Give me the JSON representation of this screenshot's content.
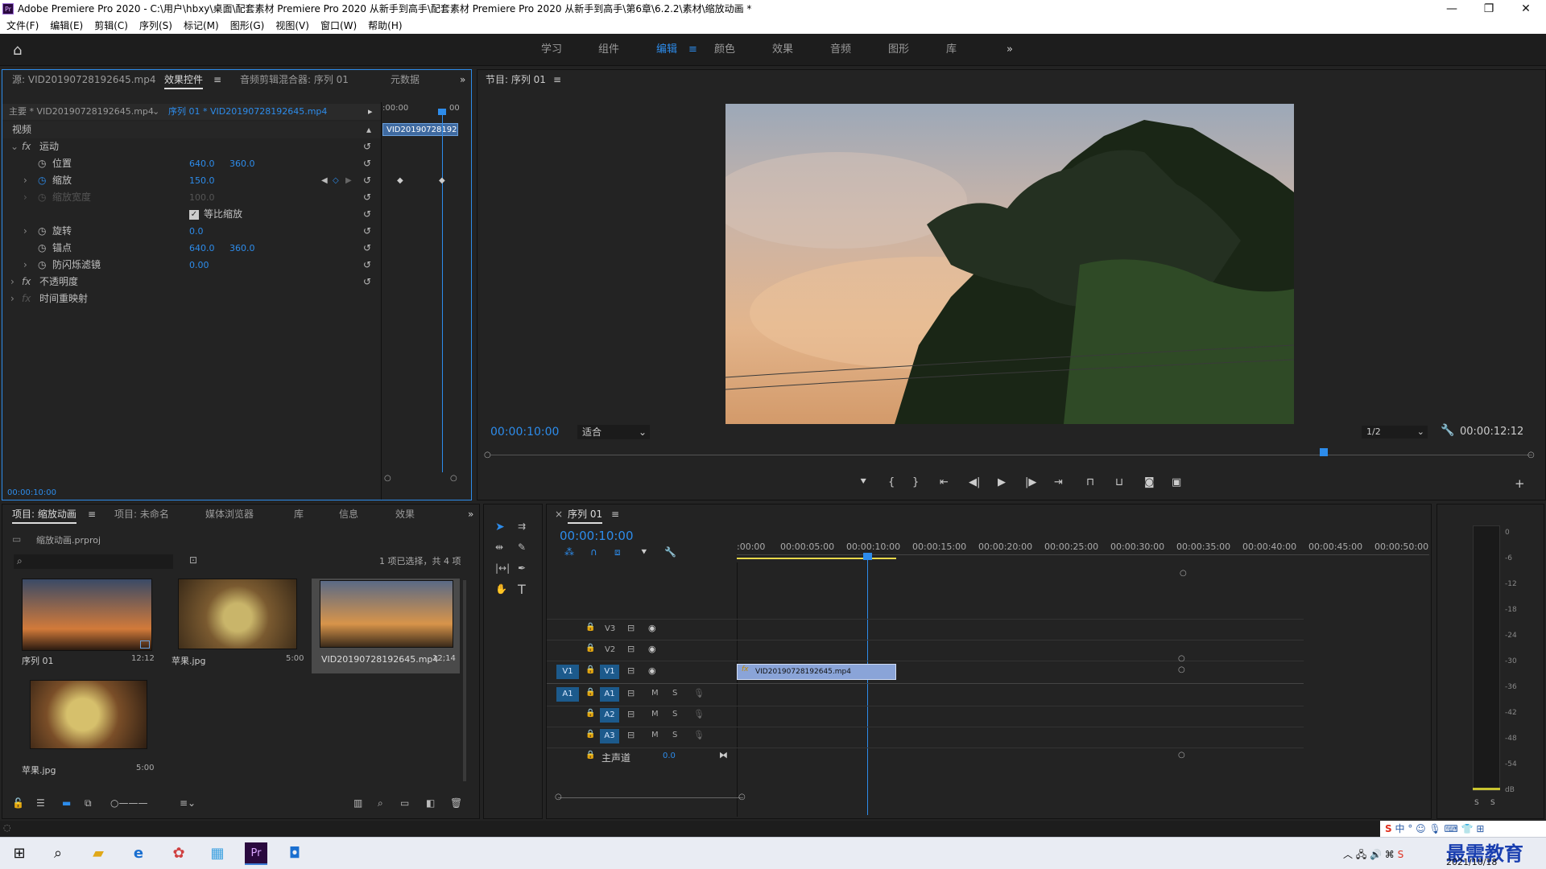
{
  "titlebar": {
    "title": "Adobe Premiere Pro 2020 - C:\\用户\\hbxy\\桌面\\配套素材 Premiere Pro 2020 从新手到高手\\配套素材 Premiere Pro 2020 从新手到高手\\第6章\\6.2.2\\素材\\缩放动画 *",
    "minimize": "—",
    "maximize": "❐",
    "close": "✕"
  },
  "menu": [
    "文件(F)",
    "编辑(E)",
    "剪辑(C)",
    "序列(S)",
    "标记(M)",
    "图形(G)",
    "视图(V)",
    "窗口(W)",
    "帮助(H)"
  ],
  "workspaces": [
    "学习",
    "组件",
    "编辑",
    "颜色",
    "效果",
    "音频",
    "图形",
    "库"
  ],
  "workspace_active": "编辑",
  "effect_panel": {
    "tabs": [
      "源: VID20190728192645.mp4",
      "效果控件",
      "音频剪辑混合器: 序列 01",
      "元数据"
    ],
    "master": "主要 * VID20190728192645.mp4",
    "seq": "序列 01 * VID20190728192645.mp4",
    "time_start": ":00:00",
    "time_end": "00",
    "clip_name": "VID20190728192645.mp4",
    "section_video": "视频",
    "motion": "运动",
    "props": [
      {
        "name": "位置",
        "v1": "640.0",
        "v2": "360.0"
      },
      {
        "name": "缩放",
        "v1": "150.0",
        "v2": ""
      },
      {
        "name": "缩放宽度",
        "v1": "100.0",
        "v2": ""
      },
      {
        "name": "等比缩放",
        "v1": "",
        "v2": ""
      },
      {
        "name": "旋转",
        "v1": "0.0",
        "v2": ""
      },
      {
        "name": "锚点",
        "v1": "640.0",
        "v2": "360.0"
      },
      {
        "name": "防闪烁滤镜",
        "v1": "0.00",
        "v2": ""
      }
    ],
    "opacity": "不透明度",
    "time_remap": "时间重映射",
    "timecode": "00:00:10:00"
  },
  "program_monitor": {
    "title": "节目: 序列 01",
    "timecode": "00:00:10:00",
    "fit": "适合",
    "quality": "1/2",
    "duration": "00:00:12:12"
  },
  "project_panel": {
    "tabs": [
      "项目: 缩放动画",
      "项目: 未命名",
      "媒体浏览器",
      "库",
      "信息",
      "效果"
    ],
    "project_file": "缩放动画.prproj",
    "selection": "1 项已选择，共 4 项",
    "items": [
      {
        "name": "序列 01",
        "duration": "12:12"
      },
      {
        "name": "苹果.jpg",
        "duration": "5:00"
      },
      {
        "name": "VID20190728192645.mp4",
        "duration": "12;14"
      },
      {
        "name": "苹果.jpg",
        "duration": "5:00"
      }
    ]
  },
  "timeline": {
    "title": "序列 01",
    "timecode": "00:00:10:00",
    "ruler": [
      ":00:00",
      "00:00:05:00",
      "00:00:10:00",
      "00:00:15:00",
      "00:00:20:00",
      "00:00:25:00",
      "00:00:30:00",
      "00:00:35:00",
      "00:00:40:00",
      "00:00:45:00",
      "00:00:50:00"
    ],
    "video_tracks": [
      "V3",
      "V2",
      "V1"
    ],
    "audio_tracks": [
      "A1",
      "A2",
      "A3"
    ],
    "master": "主声道",
    "master_val": "0.0",
    "clip": "VID20190728192645.mp4",
    "m": "M",
    "s": "S"
  },
  "meter": [
    "0",
    "-6",
    "-12",
    "-18",
    "-24",
    "-30",
    "-36",
    "-42",
    "-48",
    "-54",
    "dB"
  ],
  "meter_solo": [
    "S",
    "S"
  ],
  "taskbar": {
    "date": "2021/10/18",
    "ime": "中",
    "watermark": "最需教育"
  }
}
